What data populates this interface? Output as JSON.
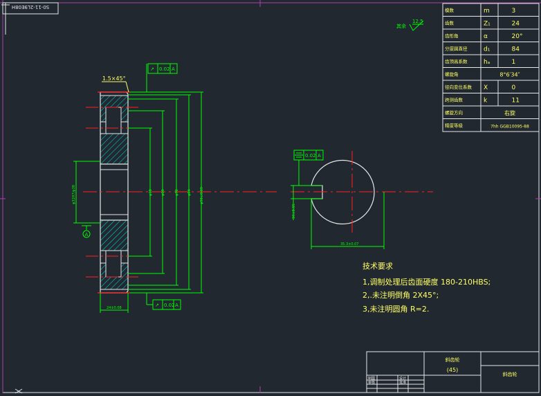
{
  "colors": {
    "background": "#212830",
    "line_white": "#e8e8e8",
    "line_green": "#00ff00",
    "line_red": "#ff2020",
    "hatch_cyan": "#00c8c8",
    "text_yellow": "#ffff66",
    "border_magenta": "#b040b0"
  },
  "top_left_tag": "S0-11-2L9E08H",
  "gear_params": [
    {
      "label": "模数",
      "symbol": "m",
      "value": "3"
    },
    {
      "label": "齿数",
      "symbol": "Z₁",
      "value": "24"
    },
    {
      "label": "齿形角",
      "symbol": "α",
      "value": "20°"
    },
    {
      "label": "分度圆直径",
      "symbol": "d₁",
      "value": "84"
    },
    {
      "label": "齿顶高系数",
      "symbol": "hₐ",
      "value": "1"
    },
    {
      "label": "螺旋角",
      "symbol": "",
      "value": "8°6′34″"
    },
    {
      "label": "径向变位系数",
      "symbol": "X",
      "value": "0"
    },
    {
      "label": "跨测齿数",
      "symbol": "k",
      "value": "11"
    },
    {
      "label": "螺旋方向",
      "symbol": "",
      "value": "右旋"
    },
    {
      "label": "精度等级",
      "symbol": "",
      "value": "7hh GGB10095-88"
    }
  ],
  "roughness": {
    "prefix": "其余",
    "value": "12.5"
  },
  "section_view": {
    "chamfer": "1.5×45°",
    "runout_top": "0.02",
    "runout_bottom": "0.02",
    "datum_label": "A",
    "bore_dim": "φ32H7/φ38",
    "dims_right": [
      "φ38",
      "φ60",
      "φ78",
      "φ84",
      "φ90±0.09"
    ],
    "width_dim": "24±0.08"
  },
  "side_view": {
    "symmetry_tol": "0.02",
    "datum": "A",
    "keyway_dim": "10±0.05",
    "bore_height_dim": "35.3±0.07"
  },
  "tech_requirements": {
    "title": "技术要求",
    "items": [
      "1,调制处理后齿面硬度 180-210HBS;",
      "2,.未注明倒角 2X45°;",
      "3,未注明圆角 R=2."
    ]
  },
  "title_block": {
    "part_name": "斜齿轮",
    "material": "(45)",
    "drawing_name": "斜齿轮",
    "rows": [
      "制图",
      "审核",
      "设计",
      "批准"
    ]
  }
}
